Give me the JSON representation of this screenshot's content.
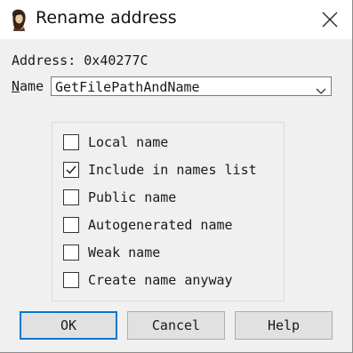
{
  "window": {
    "title": "Rename address",
    "icon": "app-portrait-icon",
    "close_icon": "close-icon"
  },
  "address": {
    "text": "Address: 0x40277C"
  },
  "name_field": {
    "label_underlined": "N",
    "label_rest": "ame",
    "value": "GetFilePathAndName",
    "dropdown_icon": "chevron-down-icon"
  },
  "options": [
    {
      "label": "Local name",
      "checked": false
    },
    {
      "label": "Include in names list",
      "checked": true
    },
    {
      "label": "Public name",
      "checked": false
    },
    {
      "label": "Autogenerated name",
      "checked": false
    },
    {
      "label": "Weak name",
      "checked": false
    },
    {
      "label": "Create name anyway",
      "checked": false
    }
  ],
  "buttons": {
    "ok": "OK",
    "cancel": "Cancel",
    "help": "Help"
  },
  "colors": {
    "accent": "#0078d7",
    "titlebar": "#ffffff",
    "dialog_bg": "#f0f0f0"
  }
}
